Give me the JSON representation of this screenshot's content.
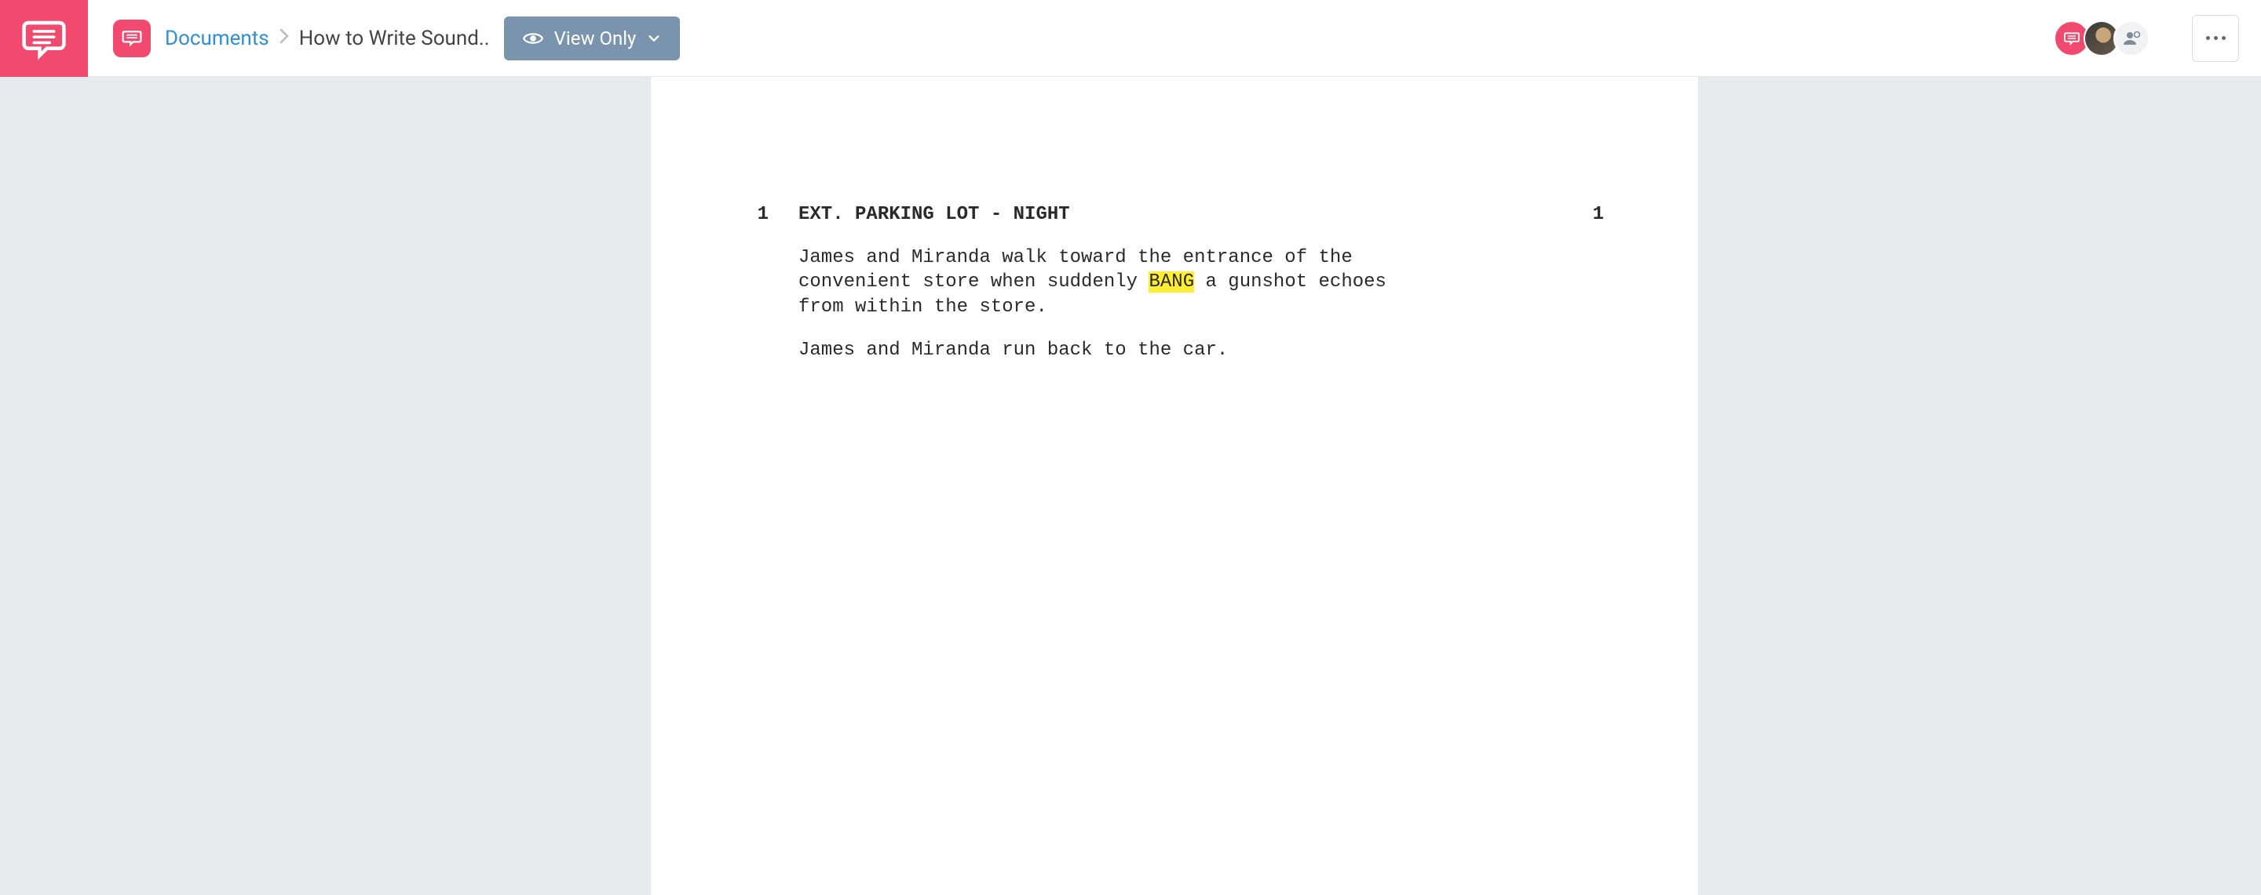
{
  "brand": {
    "name": "app-logo"
  },
  "breadcrumb": {
    "root": "Documents",
    "current": "How to Write Sound.."
  },
  "view_mode": {
    "label": "View Only"
  },
  "script": {
    "scene_number_left": "1",
    "scene_number_right": "1",
    "scene_heading": "EXT. PARKING LOT - NIGHT",
    "action1_pre": "James and Miranda walk toward the entrance of the convenient store when suddenly ",
    "action1_highlight": "BANG",
    "action1_post": " a gunshot echoes from within the store.",
    "action2": "James and Miranda run back to the car."
  }
}
